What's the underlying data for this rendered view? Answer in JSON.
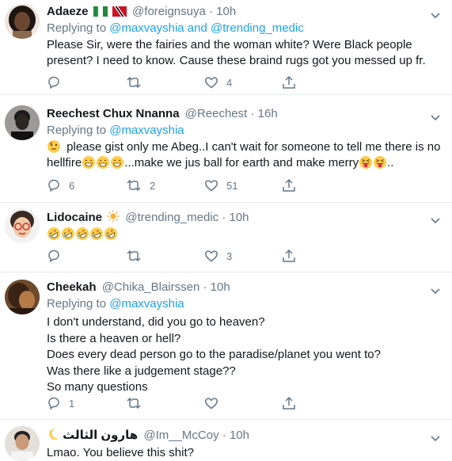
{
  "tweets": [
    {
      "name": "Adaeze",
      "handle": "@foreignsuya",
      "time": "10h",
      "replying_label": "Replying to",
      "replying_to": "@maxvayshia and @trending_medic",
      "body_lines": [
        "Please Sir, were the fairies and the woman white? Were Black people",
        "present? I need to know. Cause these braind rugs got you messed up fr."
      ],
      "counts": {
        "reply": "",
        "retweet": "",
        "like": "4"
      }
    },
    {
      "name": "Reechest Chux Nnanna",
      "handle": "@Reechest",
      "time": "16h",
      "replying_label": "Replying to",
      "replying_to": "@maxvayshia",
      "body_lines": [
        "please gist only me Abeg..I can't wait for someone to tell me there is no",
        "hellfire",
        "...make we jus ball for earth and make merry",
        ".."
      ],
      "counts": {
        "reply": "6",
        "retweet": "2",
        "like": "51"
      }
    },
    {
      "name": "Lidocaine",
      "handle": "@trending_medic",
      "time": "10h",
      "counts": {
        "reply": "",
        "retweet": "",
        "like": "3"
      }
    },
    {
      "name": "Cheekah",
      "handle": "@Chika_Blairssen",
      "time": "10h",
      "replying_label": "Replying to",
      "replying_to": "@maxvayshia",
      "body_lines": [
        "I don't understand, did you go to heaven?",
        "Is there a heaven or hell?",
        "Does every dead person go to the paradise/planet you went to?",
        "Was there like a judgement stage??",
        "So many questions"
      ],
      "counts": {
        "reply": "1",
        "retweet": "",
        "like": ""
      }
    },
    {
      "name": "هارون الثالث",
      "handle": "@Im__McCoy",
      "time": "10h",
      "body_lines": [
        "Lmao. You believe this shit?"
      ]
    }
  ],
  "separator": "·",
  "colors": {
    "link": "#1da1f2",
    "meta": "#657786",
    "divider": "#e6ecf0"
  }
}
